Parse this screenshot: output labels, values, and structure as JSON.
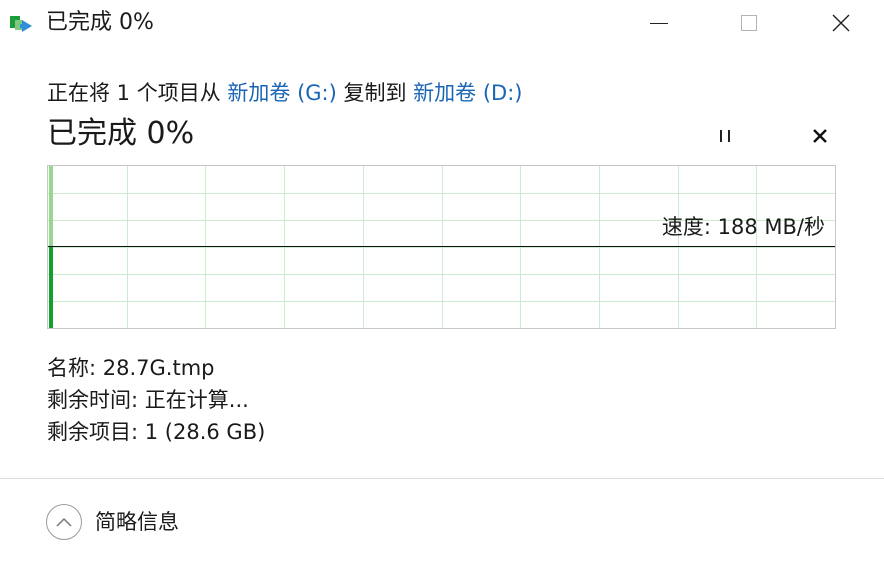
{
  "window": {
    "title": "已完成 0%",
    "minimize_icon": "minimize-icon",
    "maximize_icon": "maximize-icon",
    "close_icon": "close-icon"
  },
  "copy_line": {
    "prefix": "正在将 1 个项目从 ",
    "source": "新加卷 (G:)",
    "middle": " 复制到 ",
    "destination": "新加卷 (D:)",
    "link_color": "#1a66b5"
  },
  "progress": {
    "title": "已完成 0%",
    "percent": 0,
    "pause_icon": "pause-icon",
    "cancel_icon": "cancel-icon"
  },
  "speed_graph": {
    "speed_label": "速度: 188 MB/秒",
    "fill_colors": {
      "light": "#97d88f",
      "dark": "#15a02d",
      "grid": "#cdeccf"
    }
  },
  "details": {
    "name_label": "名称: ",
    "name_value": "28.7G.tmp",
    "time_label": "剩余时间: ",
    "time_value": "正在计算...",
    "items_label": "剩余项目: ",
    "items_value": "1 (28.6 GB)"
  },
  "footer": {
    "toggle_label": "简略信息",
    "toggle_icon": "chevron-up-icon"
  }
}
